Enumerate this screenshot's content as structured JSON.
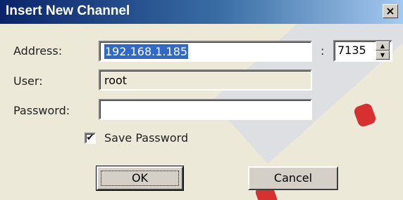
{
  "dialog": {
    "title": "Insert New Channel",
    "close_label": "×"
  },
  "fields": {
    "address_label": "Address:",
    "address_value": "192.168.1.185",
    "port_separator": ":",
    "port_value": "7135",
    "user_label": "User:",
    "user_value": "root",
    "password_label": "Password:",
    "password_value": ""
  },
  "save_password": {
    "label": "Save Password",
    "checked": true,
    "check_mark": "✔"
  },
  "buttons": {
    "ok_label": "OK",
    "cancel_label": "Cancel"
  },
  "spinner": {
    "up_glyph": "▲",
    "down_glyph": "▼"
  },
  "colors": {
    "titlebar_start": "#0a246a",
    "titlebar_end": "#a6caf0",
    "selection": "#316ac5",
    "dialog_bg": "#ece9d8"
  }
}
